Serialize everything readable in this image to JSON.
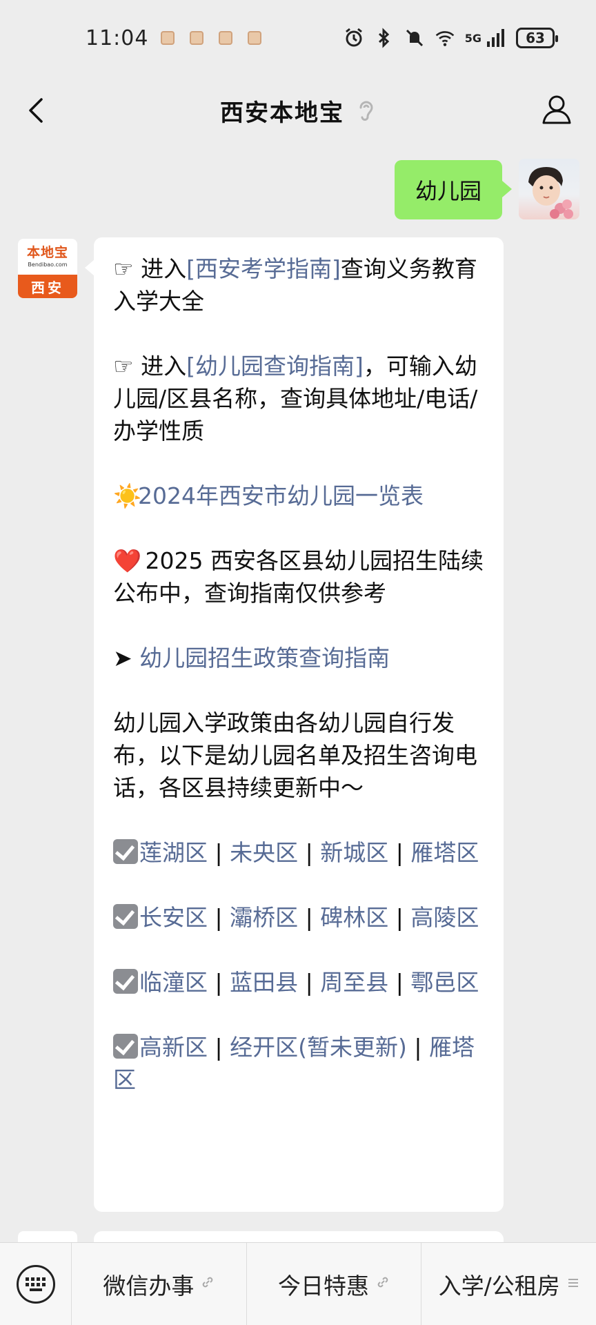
{
  "status_bar": {
    "time": "11:04",
    "network": "5G",
    "battery": "63"
  },
  "nav": {
    "title": "西安本地宝"
  },
  "chat": {
    "user_message": "幼儿园",
    "bot_avatar": {
      "logo": "本地宝",
      "domain": "Bendibao.com",
      "city": "西安"
    },
    "bot_message": {
      "p1_prefix": "☞ 进入",
      "p1_link": "[西安考学指南]",
      "p1_suffix": "查询义务教育入学大全",
      "p2_prefix": "☞ 进入",
      "p2_link": "[幼儿园查询指南]",
      "p2_suffix": "，可输入幼儿园/区县名称，查询具体地址/电话/办学性质",
      "p3_emoji": "☀️",
      "p3_link": "2024年西安市幼儿园一览表",
      "p4_emoji": "❤️",
      "p4_text": " 2025 西安各区县幼儿园招生陆续公布中，查询指南仅供参考",
      "p5_arrow": "➤ ",
      "p5_link": "幼儿园招生政策查询指南",
      "p6_text": "幼儿园入学政策由各幼儿园自行发布，以下是幼儿园名单及招生咨询电话，各区县持续更新中～",
      "group1": [
        "莲湖区",
        "未央区",
        "新城区",
        "雁塔区"
      ],
      "group2": [
        "长安区",
        "灞桥区",
        "碑林区",
        "高陵区"
      ],
      "group3": [
        "临潼区",
        "蓝田县",
        "周至县",
        "鄠邑区"
      ],
      "group4": [
        "高新区",
        "经开区(暂未更新)",
        "雁塔区"
      ]
    }
  },
  "bottom_menu": {
    "item1": "微信办事",
    "item2": "今日特惠",
    "item3": "入学/公租房"
  },
  "colors": {
    "link": "#576b95",
    "user_bubble": "#95ec69",
    "background": "#ededed",
    "brand_orange": "#e85a1c"
  }
}
